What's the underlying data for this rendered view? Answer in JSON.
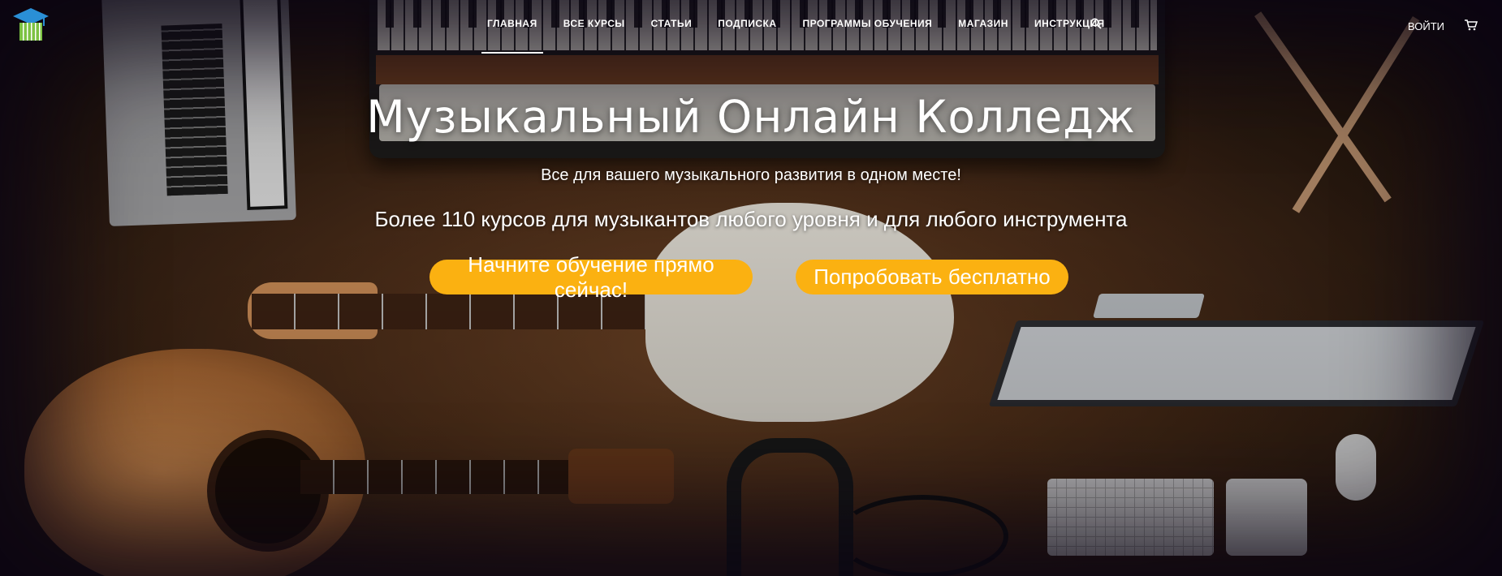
{
  "header": {
    "logo_icon": "graduation-cap-piano-logo",
    "nav": [
      {
        "label": "ГЛАВНАЯ",
        "active": true
      },
      {
        "label": "ВСЕ КУРСЫ",
        "active": false
      },
      {
        "label": "СТАТЬИ",
        "active": false
      },
      {
        "label": "ПОДПИСКА",
        "active": false
      },
      {
        "label": "ПРОГРАММЫ ОБУЧЕНИЯ",
        "active": false
      },
      {
        "label": "МАГАЗИН",
        "active": false
      },
      {
        "label": "ИНСТРУКЦИЯ",
        "active": false
      }
    ],
    "search_icon": "search-icon",
    "login_label": "ВОЙТИ",
    "cart_icon": "cart-icon"
  },
  "hero": {
    "title": "Музыкальный Онлайн Колледж",
    "subtitle": "Все для вашего музыкального развития в одном месте!",
    "tagline": "Более 110 курсов для музыкантов любого уровня и для любого инструмента",
    "primary_button": "Начните обучение прямо сейчас!",
    "secondary_button": "Попробовать бесплатно"
  },
  "colors": {
    "accent": "#fbb111",
    "logo_blue": "#2a8fd6",
    "logo_green": "#7cc242",
    "text": "#ffffff"
  }
}
